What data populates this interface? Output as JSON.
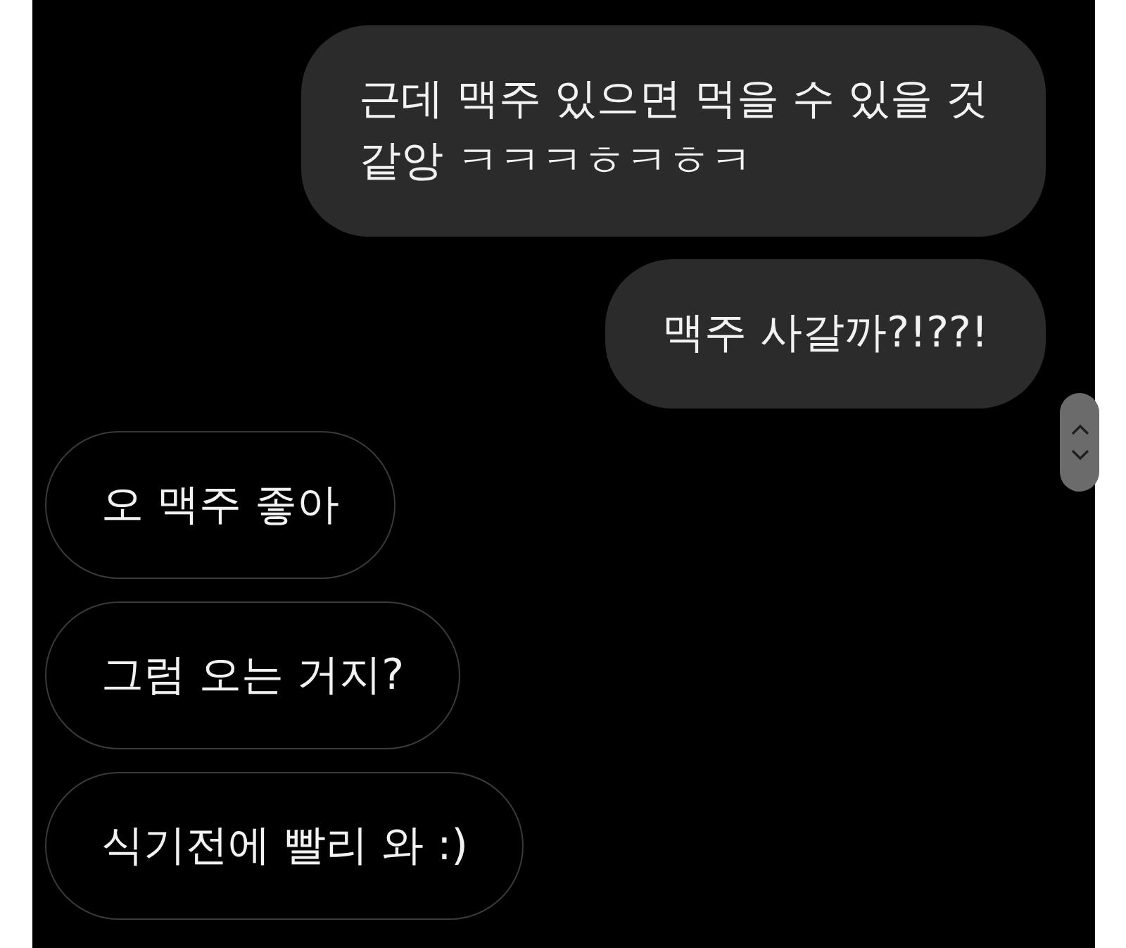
{
  "messages": [
    {
      "kind": "sent",
      "text": "근데 맥주 있으면 먹을 수 있을 것\n같앙 ㅋㅋㅋㅎㅋㅎㅋ"
    },
    {
      "kind": "sent",
      "text": "맥주 사갈까?!??!"
    },
    {
      "kind": "received",
      "text": "오 맥주 좋아"
    },
    {
      "kind": "received",
      "text": "그럼 오는 거지?"
    },
    {
      "kind": "received",
      "text": "식기전에 빨리 와 :)"
    }
  ]
}
